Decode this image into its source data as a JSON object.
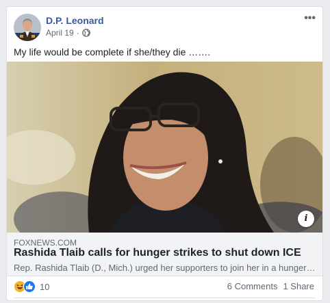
{
  "post": {
    "author": "D.P. Leonard",
    "date": "April 19",
    "separator": "·",
    "privacy_icon": "globe-icon",
    "more_icon": "more-options-icon",
    "more_label": "•••",
    "text": "My life would be complete if she/they die ……."
  },
  "link": {
    "domain": "FOXNEWS.COM",
    "headline": "Rashida Tlaib calls for hunger strikes to shut down ICE",
    "description": "Rep. Rashida Tlaib (D., Mich.) urged her supporters to join her in a hunger strike to shut down ICE",
    "info_label": "i"
  },
  "engagement": {
    "reaction_icons": [
      "haha-reaction-icon",
      "like-reaction-icon"
    ],
    "reaction_count": "10",
    "comments": "6 Comments",
    "shares": "1 Share"
  },
  "colors": {
    "author": "#385898",
    "secondary_text": "#606770",
    "link_bg": "#f2f3f5",
    "like_blue": "#1877f2",
    "haha_yellow": "#f7b125"
  }
}
